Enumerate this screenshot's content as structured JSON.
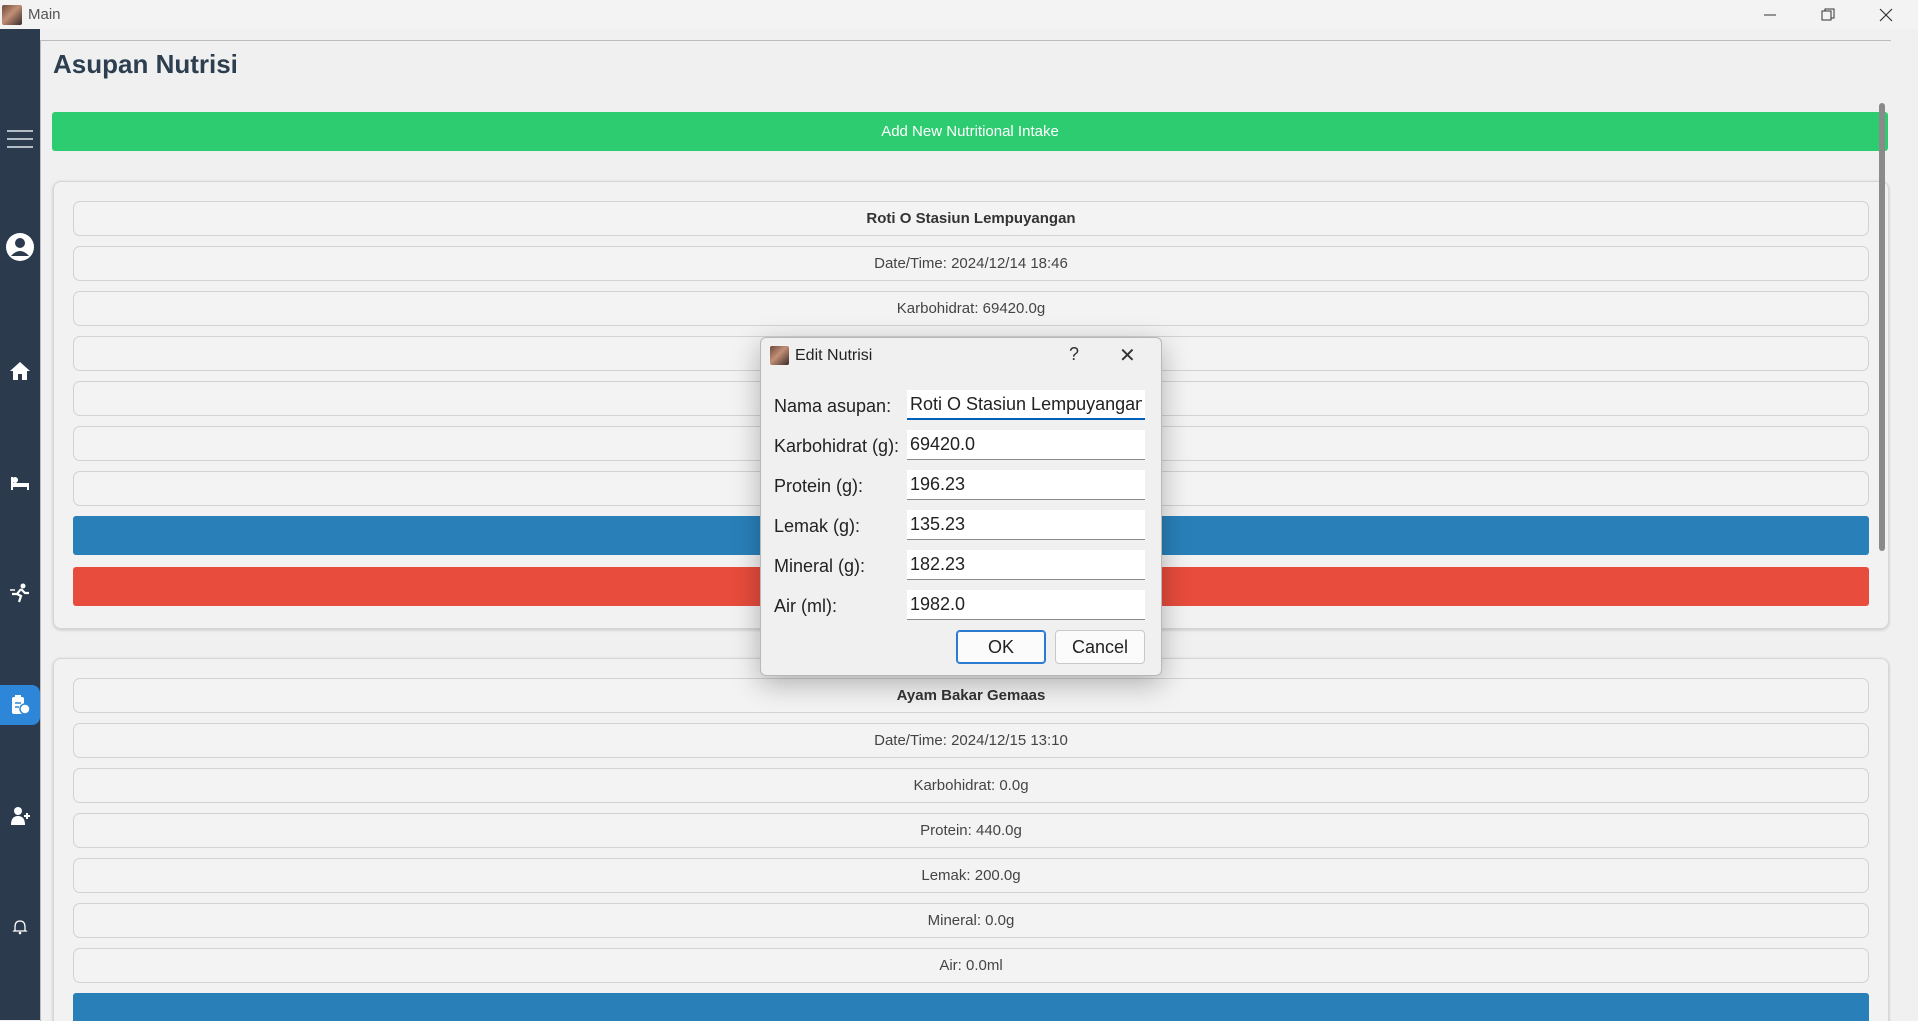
{
  "window": {
    "title": "Main",
    "minimize": "—",
    "restore": "❐",
    "close": "✕"
  },
  "page": {
    "title": "Asupan Nutrisi",
    "add_button": "Add New Nutritional Intake"
  },
  "entries": [
    {
      "name": "Roti O Stasiun Lempuyangan",
      "datetime": "Date/Time: 2024/12/14 18:46",
      "karbohidrat": "Karbohidrat: 69420.0g"
    },
    {
      "name": "Ayam Bakar Gemaas",
      "datetime": "Date/Time: 2024/12/15 13:10",
      "karbohidrat": "Karbohidrat: 0.0g",
      "protein": "Protein: 440.0g",
      "lemak": "Lemak: 200.0g",
      "mineral": "Mineral: 0.0g",
      "air": "Air: 0.0ml"
    }
  ],
  "dialog": {
    "title": "Edit Nutrisi",
    "help": "?",
    "close": "✕",
    "fields": [
      {
        "label": "Nama asupan:",
        "value": "Roti O Stasiun Lempuyangan"
      },
      {
        "label": "Karbohidrat (g):",
        "value": "69420.0"
      },
      {
        "label": "Protein (g):",
        "value": "196.23"
      },
      {
        "label": "Lemak (g):",
        "value": "135.23"
      },
      {
        "label": "Mineral (g):",
        "value": "182.23"
      },
      {
        "label": "Air (ml):",
        "value": "1982.0"
      }
    ],
    "ok": "OK",
    "cancel": "Cancel"
  },
  "colors": {
    "sidebar": "#2b3a4d",
    "active": "#2e86d9",
    "add": "#2ecc71",
    "edit": "#2980b9",
    "delete": "#e74c3c"
  }
}
